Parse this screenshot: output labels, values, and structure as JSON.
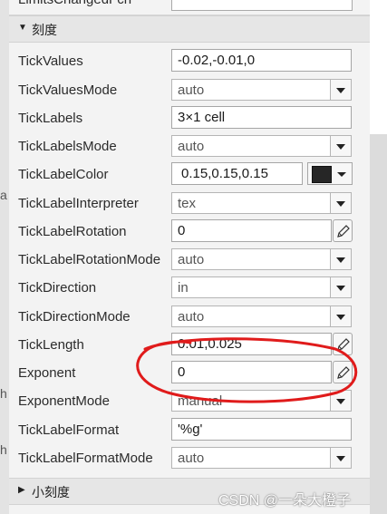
{
  "top_row": {
    "name": "LimitsChangedFcn"
  },
  "sections": {
    "ticks": "刻度",
    "minor_ticks": "小刻度"
  },
  "props": {
    "tick_values": {
      "name": "TickValues",
      "value": "-0.02,-0.01,0"
    },
    "tick_values_mode": {
      "name": "TickValuesMode",
      "value": "auto"
    },
    "tick_labels": {
      "name": "TickLabels",
      "value": "3×1 cell"
    },
    "tick_labels_mode": {
      "name": "TickLabelsMode",
      "value": "auto"
    },
    "tick_label_color": {
      "name": "TickLabelColor",
      "value": "0.15,0.15,0.15",
      "swatch": "#262626"
    },
    "tick_label_interpreter": {
      "name": "TickLabelInterpreter",
      "value": "tex"
    },
    "tick_label_rotation": {
      "name": "TickLabelRotation",
      "value": "0"
    },
    "tick_label_rotation_mode": {
      "name": "TickLabelRotationMode",
      "value": "auto"
    },
    "tick_direction": {
      "name": "TickDirection",
      "value": "in"
    },
    "tick_direction_mode": {
      "name": "TickDirectionMode",
      "value": "auto"
    },
    "tick_length": {
      "name": "TickLength",
      "value": "0.01,0.025"
    },
    "exponent": {
      "name": "Exponent",
      "value": "0"
    },
    "exponent_mode": {
      "name": "ExponentMode",
      "value": "manual"
    },
    "tick_label_format": {
      "name": "TickLabelFormat",
      "value": "'%g'"
    },
    "tick_label_format_mode": {
      "name": "TickLabelFormatMode",
      "value": "auto"
    }
  },
  "icons": {
    "section_expanded": "triangle-down-icon",
    "section_collapsed": "triangle-right-icon",
    "edit": "pencil-icon",
    "dropdown": "chevron-down-icon"
  },
  "colors": {
    "annotation": "#e01b1b",
    "swatch": "#262626"
  },
  "watermark": "CSDN @一朵大橙子"
}
